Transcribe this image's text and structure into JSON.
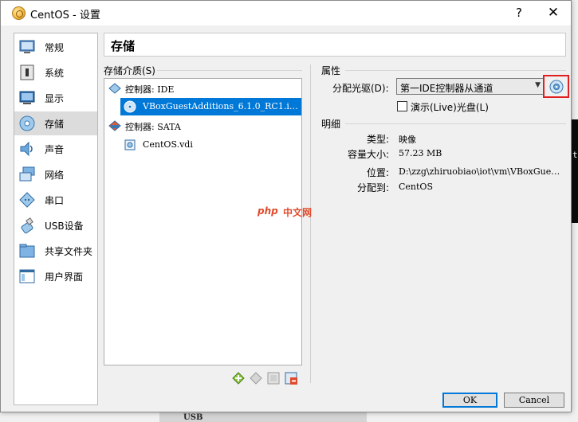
{
  "window": {
    "title": "CentOS - 设置",
    "help_button": "?",
    "close_button": "✕"
  },
  "sidebar": {
    "items": [
      {
        "label": "常规",
        "icon": "general-icon"
      },
      {
        "label": "系统",
        "icon": "system-icon"
      },
      {
        "label": "显示",
        "icon": "display-icon"
      },
      {
        "label": "存储",
        "icon": "storage-icon",
        "selected": true
      },
      {
        "label": "声音",
        "icon": "audio-icon"
      },
      {
        "label": "网络",
        "icon": "network-icon"
      },
      {
        "label": "串口",
        "icon": "serial-port-icon"
      },
      {
        "label": "USB设备",
        "icon": "usb-icon"
      },
      {
        "label": "共享文件夹",
        "icon": "shared-folder-icon"
      },
      {
        "label": "用户界面",
        "icon": "user-interface-icon"
      }
    ]
  },
  "section": {
    "title": "存储"
  },
  "storage_tree": {
    "label": "存储介质(S)",
    "rows": [
      {
        "label": "控制器: IDE",
        "icon": "ide-controller-icon"
      },
      {
        "label": "VBoxGuestAdditions_6.1.0_RC1.i…",
        "icon": "optical-disc-icon",
        "selected": true
      },
      {
        "label": "控制器: SATA",
        "icon": "sata-controller-icon"
      },
      {
        "label": "CentOS.vdi",
        "icon": "hard-disk-icon"
      }
    ],
    "toolbar": [
      "add-controller-icon",
      "remove-controller-icon",
      "add-attachment-icon",
      "remove-attachment-icon"
    ]
  },
  "attributes": {
    "label": "属性",
    "optical_drive_label": "分配光驱(D):",
    "optical_drive_value": "第一IDE控制器从通道",
    "live_cd_label": "演示(Live)光盘(L)",
    "live_cd_checked": false
  },
  "details": {
    "label": "明细",
    "rows": [
      {
        "label": "类型:",
        "value": "映像"
      },
      {
        "label": "容量大小:",
        "value": "57.23  MB"
      },
      {
        "label": "位置:",
        "value": "D:\\zzg\\zhiruobiao\\iot\\vm\\VBoxGue…"
      },
      {
        "label": "分配到:",
        "value": "CentOS"
      }
    ]
  },
  "buttons": {
    "ok": "OK",
    "cancel": "Cancel"
  },
  "background": {
    "bottom_text": "USB",
    "right_text": "t"
  },
  "watermark": {
    "php": "php",
    "site": "中文网"
  },
  "colors": {
    "selection": "#0078d7",
    "highlight_frame": "#e02020"
  }
}
